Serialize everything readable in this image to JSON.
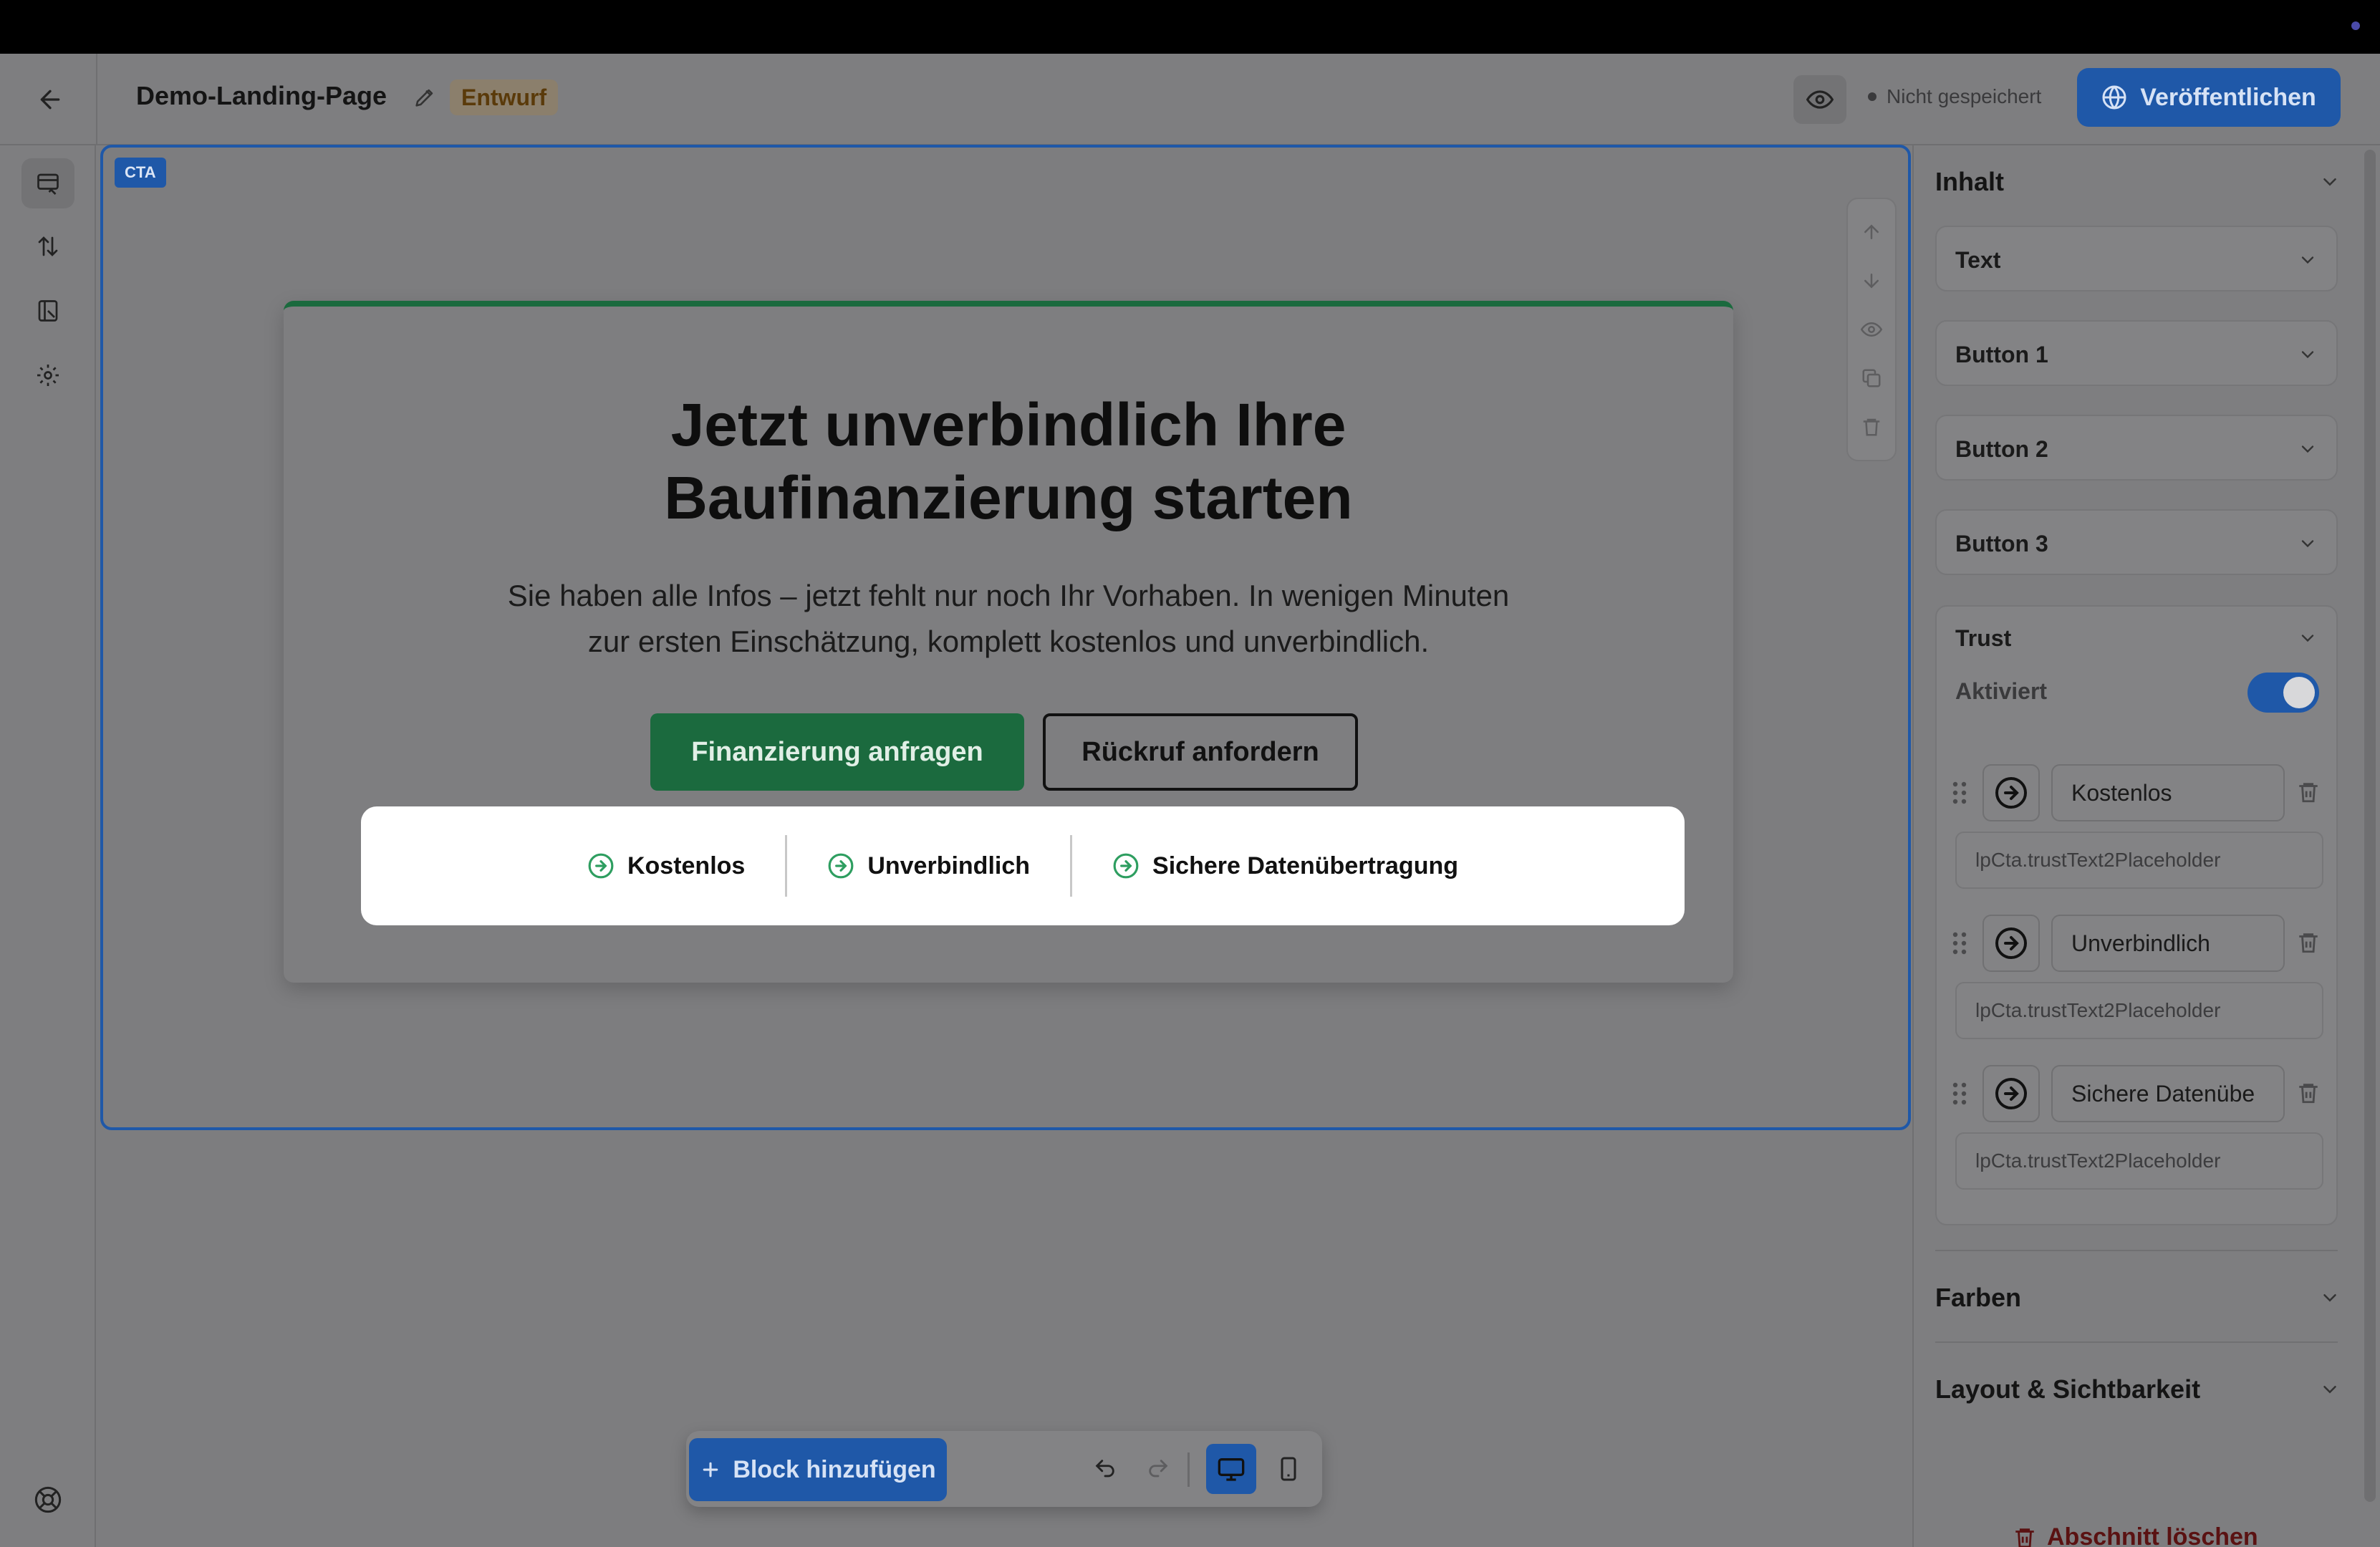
{
  "header": {
    "page_title": "Demo-Landing-Page",
    "status_badge": "Entwurf",
    "save_status": "Nicht gespeichert",
    "publish_label": "Veröffentlichen"
  },
  "canvas": {
    "block_tag": "CTA",
    "heading_line1": "Jetzt unverbindlich Ihre",
    "heading_line2": "Baufinanzierung starten",
    "subtext_line1": "Sie haben alle Infos – jetzt fehlt nur noch Ihr Vorhaben. In wenigen Minuten",
    "subtext_line2": "zur ersten Einschätzung, komplett kostenlos und unverbindlich.",
    "primary_button": "Finanzierung anfragen",
    "secondary_button": "Rückruf anfordern",
    "trust_items": [
      "Kostenlos",
      "Unverbindlich",
      "Sichere Datenübertragung"
    ]
  },
  "bottom_toolbar": {
    "add_block_label": "Block hinzufügen"
  },
  "panel": {
    "inhalt_title": "Inhalt",
    "accordions": [
      "Text",
      "Button 1",
      "Button 2",
      "Button 3"
    ],
    "trust_title": "Trust",
    "activated_label": "Aktiviert",
    "activated": true,
    "trust_rows": [
      {
        "text": "Kostenlos",
        "placeholder": "lpCta.trustText2Placeholder"
      },
      {
        "text": "Unverbindlich",
        "placeholder": "lpCta.trustText2Placeholder"
      },
      {
        "text": "Sichere Datenübe",
        "placeholder": "lpCta.trustText2Placeholder"
      }
    ],
    "colors_title": "Farben",
    "layout_title": "Layout & Sichtbarkeit",
    "delete_label": "Abschnitt löschen"
  },
  "colors": {
    "accent": "#1f58a8",
    "cta_green": "#1b6a3e",
    "draft_badge": "#8b7f6c"
  }
}
